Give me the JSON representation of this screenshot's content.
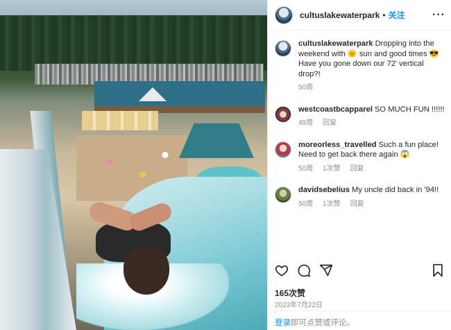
{
  "post": {
    "username": "cultuslakewaterpark",
    "separator": "•",
    "follow_label": "关注",
    "more_label": "···"
  },
  "caption": {
    "username": "cultuslakewaterpark",
    "text": "Dropping into the weekend with 🌞 sun and good times 😎 Have you gone down our 72' vertical drop?!",
    "time": "50周"
  },
  "comments": [
    {
      "username": "westcoastbcapparel",
      "text": "SO MUCH FUN !!!!!!",
      "time": "49周",
      "reply": "回复"
    },
    {
      "username": "moreorless_travelled",
      "text": "Such a fun place! Need to get back there again 😱",
      "time": "50周",
      "likes": "1次赞",
      "reply": "回复"
    },
    {
      "username": "davidsebelius",
      "text": "My uncle did back in '94!!",
      "time": "50周",
      "likes": "1次赞",
      "reply": "回复"
    }
  ],
  "actions": {
    "icons": [
      "heart-icon",
      "comment-icon",
      "share-icon",
      "bookmark-icon"
    ]
  },
  "stats": {
    "likes": "165次赞",
    "date": "2023年7月22日"
  },
  "footer": {
    "login": "登录",
    "rest": "即可点赞或评论。"
  }
}
